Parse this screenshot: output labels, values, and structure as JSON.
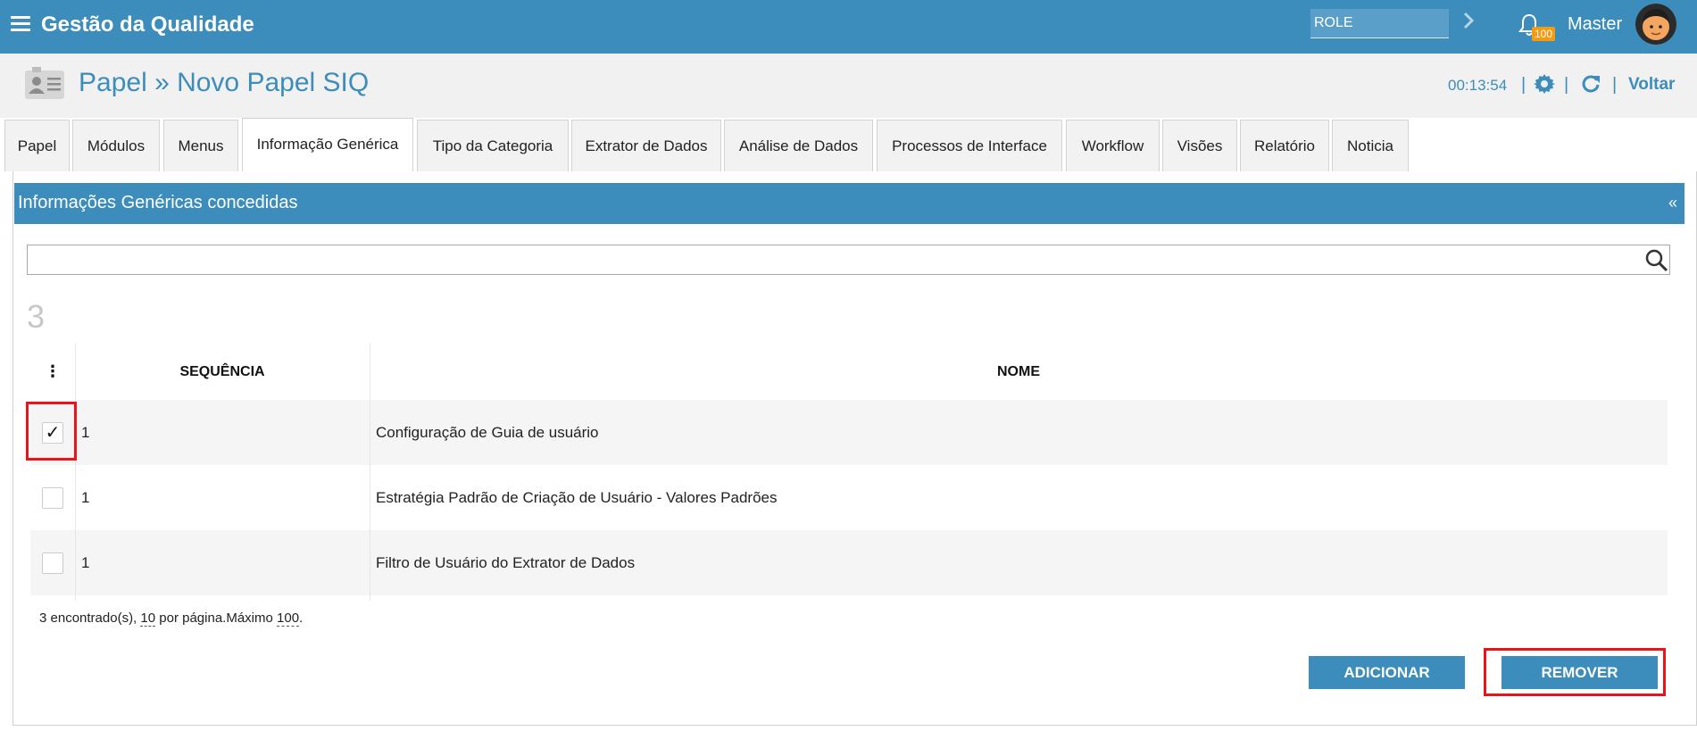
{
  "topbar": {
    "app_title": "Gestão da Qualidade",
    "role_value": "ROLE",
    "notification_count": "100",
    "user_name": "Master"
  },
  "header": {
    "title": "Papel » Novo Papel SIQ",
    "timer": "00:13:54",
    "voltar_label": "Voltar"
  },
  "tabs": [
    {
      "label": "Papel"
    },
    {
      "label": "Módulos"
    },
    {
      "label": "Menus"
    },
    {
      "label": "Informação Genérica"
    },
    {
      "label": "Tipo da Categoria"
    },
    {
      "label": "Extrator de Dados"
    },
    {
      "label": "Análise de Dados"
    },
    {
      "label": "Processos de Interface"
    },
    {
      "label": "Workflow"
    },
    {
      "label": "Visões"
    },
    {
      "label": "Relatório"
    },
    {
      "label": "Noticia"
    }
  ],
  "panel": {
    "title": "Informações Genéricas concedidas",
    "collapse_glyph": "«",
    "search_value": "",
    "count": "3"
  },
  "table": {
    "menu_glyph": "⋮",
    "columns": {
      "seq": "SEQUÊNCIA",
      "name": "NOME"
    },
    "rows": [
      {
        "checked": true,
        "check_glyph": "✓",
        "seq": "1",
        "name": "Configuração de Guia de usuário"
      },
      {
        "checked": false,
        "check_glyph": "",
        "seq": "1",
        "name": "Estratégia Padrão de Criação de Usuário - Valores Padrões"
      },
      {
        "checked": false,
        "check_glyph": "",
        "seq": "1",
        "name": "Filtro de Usuário do Extrator de Dados"
      }
    ],
    "footer": {
      "found": "3 encontrado(s),",
      "per_page": "10",
      "per_page_suffix": "por página.Máximo",
      "max": "100",
      "end": "."
    }
  },
  "buttons": {
    "add": "ADICIONAR",
    "remove": "REMOVER"
  },
  "colors": {
    "primary": "#3c8dbc",
    "badge": "#f39c12",
    "highlight": "#e8141a"
  }
}
